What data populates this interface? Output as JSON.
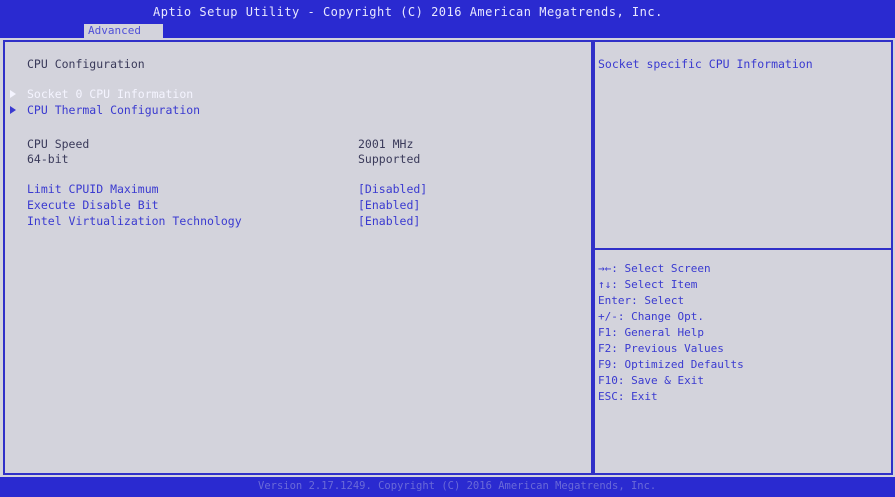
{
  "header": {
    "title": "Aptio Setup Utility - Copyright (C) 2016 American Megatrends, Inc.",
    "active_tab": "Advanced"
  },
  "main": {
    "section_title": "CPU Configuration",
    "submenus": [
      {
        "label": "Socket 0 CPU Information"
      },
      {
        "label": "CPU Thermal Configuration"
      }
    ],
    "info_rows": [
      {
        "label": "CPU Speed",
        "value": "2001 MHz"
      },
      {
        "label": "64-bit",
        "value": "Supported"
      }
    ],
    "settings": [
      {
        "label": "Limit CPUID Maximum",
        "value": "[Disabled]"
      },
      {
        "label": "Execute Disable Bit",
        "value": "[Enabled]"
      },
      {
        "label": "Intel Virtualization Technology",
        "value": "[Enabled]"
      }
    ]
  },
  "help": {
    "description": "Socket specific CPU Information",
    "keys": [
      "→←: Select Screen",
      "↑↓: Select Item",
      "Enter: Select",
      "+/-: Change Opt.",
      "F1: General Help",
      "F2: Previous Values",
      "F9: Optimized Defaults",
      "F10: Save & Exit",
      "ESC: Exit"
    ]
  },
  "footer": {
    "text": "Version 2.17.1249. Copyright (C) 2016 American Megatrends, Inc."
  },
  "colors": {
    "bar_blue": "#2a2ad0",
    "panel_bg": "#d3d3dc",
    "highlight_text": "#f4f4ff",
    "option_blue": "#3a3ad0"
  }
}
